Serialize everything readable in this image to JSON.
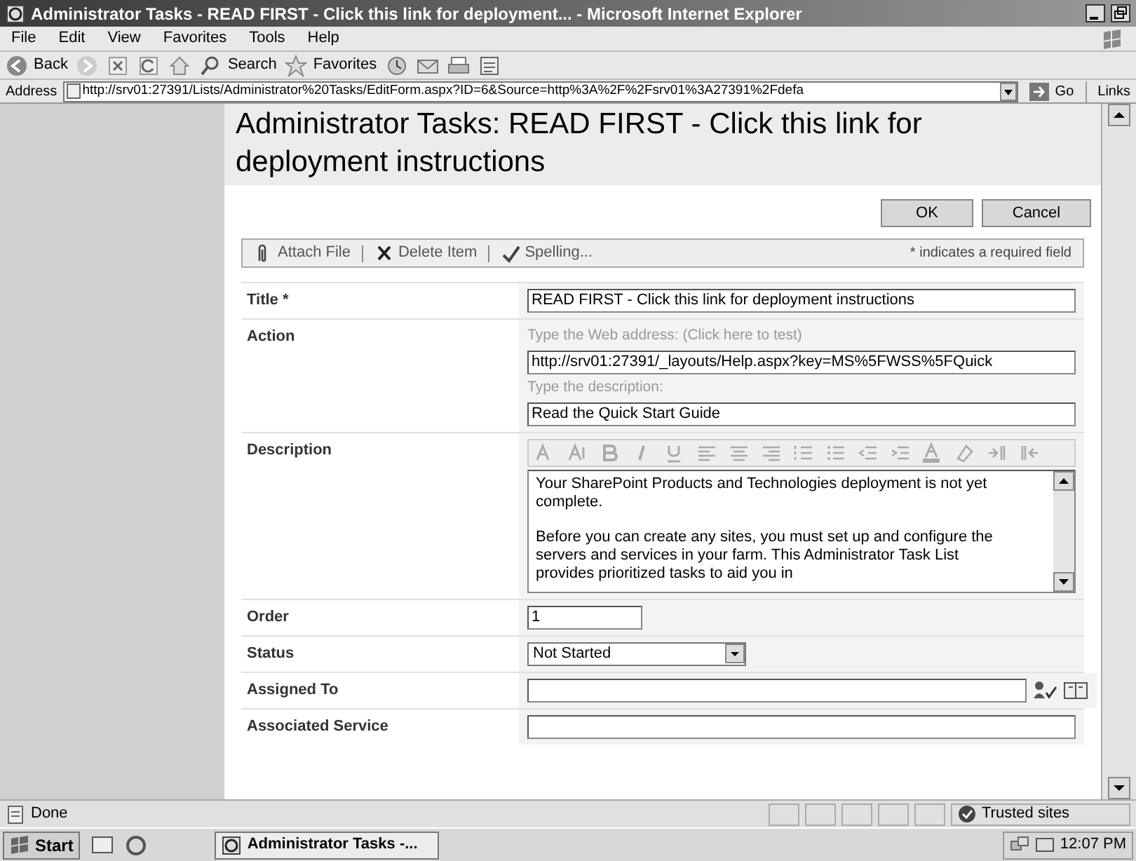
{
  "window": {
    "title": "Administrator Tasks - READ FIRST - Click this link for deployment... - Microsoft Internet Explorer"
  },
  "menu": [
    "File",
    "Edit",
    "View",
    "Favorites",
    "Tools",
    "Help"
  ],
  "toolbar": [
    {
      "kind": "back",
      "label": "Back"
    },
    {
      "kind": "forward"
    },
    {
      "kind": "stop"
    },
    {
      "kind": "refresh"
    },
    {
      "kind": "home"
    },
    {
      "kind": "search",
      "label": "Search"
    },
    {
      "kind": "favorites",
      "label": "Favorites"
    },
    {
      "kind": "history"
    },
    {
      "kind": "mail"
    },
    {
      "kind": "print"
    },
    {
      "kind": "edit"
    }
  ],
  "address": {
    "label": "Address",
    "value": "http://srv01:27391/Lists/Administrator%20Tasks/EditForm.aspx?ID=6&Source=http%3A%2F%2Fsrv01%3A27391%2Fdefa",
    "go": "Go",
    "links": "Links"
  },
  "page": {
    "heading_line_1": "Administrator Tasks: READ FIRST - Click this link for",
    "heading_line_2": "deployment instructions",
    "buttons": [
      "OK",
      "Cancel"
    ],
    "actions": [
      {
        "kind": "attach",
        "label": "Attach File"
      },
      {
        "kind": "delete",
        "label": "Delete Item"
      },
      {
        "kind": "spelling",
        "label": "Spelling..."
      }
    ],
    "required_note": "* indicates a required field",
    "fields": [
      {
        "kind": "text",
        "label": "Title *",
        "value": "READ FIRST - Click this link for deployment instructions"
      },
      {
        "kind": "url",
        "label": "Action",
        "hint_1": "Type the Web address: (Click here to test)",
        "value": "http://srv01:27391/_layouts/Help.aspx?key=MS%5FWSS%5FQuick",
        "hint_2": "Type the description:",
        "description": "Read the Quick Start Guide"
      },
      {
        "kind": "richtext",
        "label": "Description",
        "paragraphs": [
          "Your SharePoint Products and Technologies deployment is not yet complete.",
          "Before you can create any sites, you must set up and configure the servers and services in your farm. This Administrator Task List provides prioritized tasks to aid you in"
        ]
      },
      {
        "kind": "short",
        "label": "Order",
        "value": "1"
      },
      {
        "kind": "select",
        "label": "Status",
        "value": "Not Started"
      },
      {
        "kind": "people",
        "label": "Assigned To"
      },
      {
        "kind": "text",
        "label": "Associated Service"
      }
    ]
  },
  "status_bar": {
    "text": "Done",
    "zone": "Trusted sites"
  },
  "taskbar": {
    "start": "Start",
    "task": "Administrator Tasks -...",
    "clock": "12:07 PM"
  }
}
